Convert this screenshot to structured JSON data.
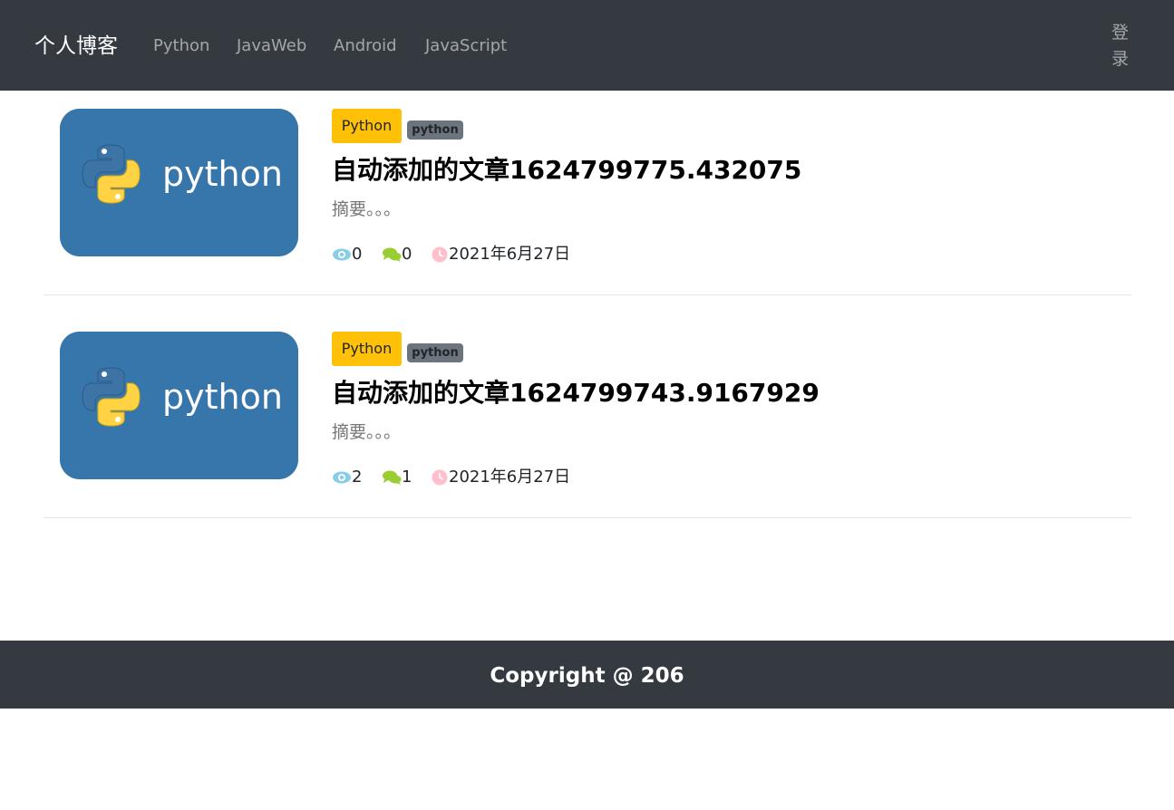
{
  "navbar": {
    "brand": "个人博客",
    "links": [
      "Python",
      "JavaWeb",
      "Android",
      "JavaScript"
    ],
    "login": "登录"
  },
  "articles": [
    {
      "category": "Python",
      "tag": "python",
      "thumbnail_text": "python",
      "title": "自动添加的文章1624799775.432075",
      "summary": "摘要。。。",
      "views": "0",
      "comments": "0",
      "date": "2021年6月27日"
    },
    {
      "category": "Python",
      "tag": "python",
      "thumbnail_text": "python",
      "title": "自动添加的文章1624799743.9167929",
      "summary": "摘要。。。",
      "views": "2",
      "comments": "1",
      "date": "2021年6月27日"
    }
  ],
  "icons": {
    "views": "eye-icon",
    "comments": "comments-icon",
    "date": "clock-icon"
  },
  "colors": {
    "navbar_bg": "#343a40",
    "category_badge": "#ffc107",
    "tag_badge": "#6c757d",
    "eye": "#87ceeb",
    "comment": "#9acd32",
    "clock": "#ffc0cb"
  },
  "footer": {
    "copyright": "Copyright @ 206"
  }
}
